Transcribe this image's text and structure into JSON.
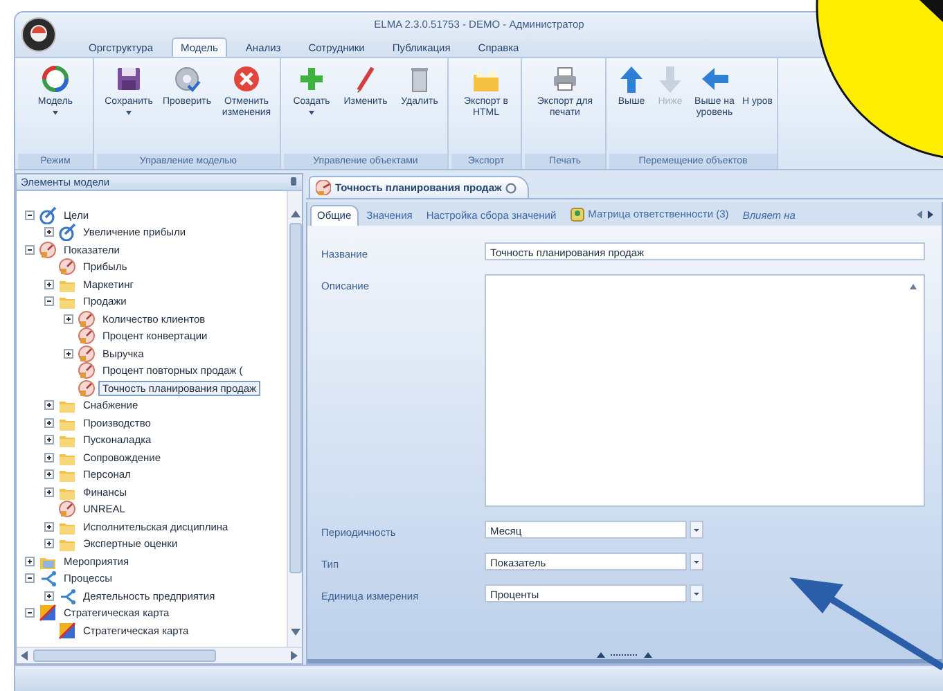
{
  "window": {
    "title": "ELMA 2.3.0.51753 - DEMO - Администратор"
  },
  "menu_tabs": [
    {
      "label": "Оргструктура",
      "selected": false
    },
    {
      "label": "Модель",
      "selected": true
    },
    {
      "label": "Анализ",
      "selected": false
    },
    {
      "label": "Сотрудники",
      "selected": false
    },
    {
      "label": "Публикация",
      "selected": false
    },
    {
      "label": "Справка",
      "selected": false
    }
  ],
  "ribbon": {
    "groups": [
      {
        "label": "Режим",
        "buttons": [
          {
            "label": "Модель",
            "has_menu": true,
            "disabled": false
          }
        ]
      },
      {
        "label": "Управление моделью",
        "buttons": [
          {
            "label": "Сохранить",
            "has_menu": true,
            "disabled": false
          },
          {
            "label": "Проверить",
            "has_menu": false,
            "disabled": false
          },
          {
            "label": "Отменить изменения",
            "has_menu": false,
            "disabled": false
          }
        ]
      },
      {
        "label": "Управление объектами",
        "buttons": [
          {
            "label": "Создать",
            "has_menu": true,
            "disabled": false
          },
          {
            "label": "Изменить",
            "has_menu": false,
            "disabled": false
          },
          {
            "label": "Удалить",
            "has_menu": false,
            "disabled": false
          }
        ]
      },
      {
        "label": "Экспорт",
        "buttons": [
          {
            "label": "Экспорт в HTML",
            "has_menu": false,
            "disabled": false
          }
        ]
      },
      {
        "label": "Печать",
        "buttons": [
          {
            "label": "Экспорт для печати",
            "has_menu": false,
            "disabled": false
          }
        ]
      },
      {
        "label": "Перемещение объектов",
        "buttons": [
          {
            "label": "Выше",
            "has_menu": false,
            "disabled": false
          },
          {
            "label": "Ниже",
            "has_menu": false,
            "disabled": true
          },
          {
            "label": "Выше на уровень",
            "has_menu": false,
            "disabled": false
          },
          {
            "label": "Н уров",
            "has_menu": false,
            "disabled": false
          }
        ]
      }
    ]
  },
  "model_panel": {
    "title": "Элементы модели",
    "tree": [
      {
        "label": "Цели",
        "kind": "goal",
        "expanded": true,
        "selected": false,
        "children": [
          {
            "label": "Увеличение прибыли",
            "kind": "goal",
            "expanded": false,
            "selected": false
          }
        ]
      },
      {
        "label": "Показатели",
        "kind": "indicator",
        "expanded": true,
        "selected": false,
        "children": [
          {
            "label": "Прибыль",
            "kind": "indicator",
            "selected": false
          },
          {
            "label": "Маркетинг",
            "kind": "folder",
            "expanded": false,
            "selected": false
          },
          {
            "label": "Продажи",
            "kind": "folder",
            "expanded": true,
            "selected": false,
            "children": [
              {
                "label": "Количество клиентов",
                "kind": "indicator",
                "expanded": false,
                "selected": false
              },
              {
                "label": "Процент конвертации",
                "kind": "indicator",
                "selected": false
              },
              {
                "label": "Выручка",
                "kind": "indicator",
                "expanded": false,
                "selected": false
              },
              {
                "label": "Процент повторных продаж (",
                "kind": "indicator",
                "selected": false
              },
              {
                "label": "Точность планирования продаж",
                "kind": "indicator",
                "selected": true
              }
            ]
          },
          {
            "label": "Снабжение",
            "kind": "folder",
            "expanded": false,
            "selected": false
          },
          {
            "label": "Производство",
            "kind": "folder",
            "expanded": false,
            "selected": false
          },
          {
            "label": "Пусконаладка",
            "kind": "folder",
            "expanded": false,
            "selected": false
          },
          {
            "label": "Сопровождение",
            "kind": "folder",
            "expanded": false,
            "selected": false
          },
          {
            "label": "Персонал",
            "kind": "folder",
            "expanded": false,
            "selected": false
          },
          {
            "label": "Финансы",
            "kind": "folder",
            "expanded": false,
            "selected": false
          },
          {
            "label": "UNREAL",
            "kind": "indicator",
            "selected": false
          },
          {
            "label": "Исполнительская дисциплина",
            "kind": "folder",
            "expanded": false,
            "selected": false
          },
          {
            "label": "Экспертные оценки",
            "kind": "folder",
            "expanded": false,
            "selected": false
          }
        ]
      },
      {
        "label": "Мероприятия",
        "kind": "events",
        "expanded": false,
        "selected": false
      },
      {
        "label": "Процессы",
        "kind": "process",
        "expanded": true,
        "selected": false,
        "children": [
          {
            "label": "Деятельность предприятия",
            "kind": "process",
            "expanded": false,
            "selected": false
          }
        ]
      },
      {
        "label": "Стратегическая карта",
        "kind": "map",
        "expanded": true,
        "selected": false,
        "children": [
          {
            "label": "Стратегическая карта",
            "kind": "map",
            "selected": false
          }
        ]
      }
    ]
  },
  "document": {
    "tab": {
      "label": "Точность планирования продаж"
    },
    "subtabs": [
      {
        "label": "Общие",
        "kind": "text",
        "selected": true
      },
      {
        "label": "Значения",
        "kind": "text",
        "selected": false
      },
      {
        "label": "Настройка сбора значений",
        "kind": "text",
        "selected": false
      },
      {
        "label": "Матрица ответственности (3)",
        "kind": "icon",
        "selected": false
      },
      {
        "label": "Влияет на",
        "kind": "text",
        "selected": false
      }
    ],
    "fields": [
      {
        "label": "Название",
        "kind": "text",
        "value": "Точность планирования продаж"
      },
      {
        "label": "Описание",
        "kind": "memo"
      },
      {
        "label": "Периодичность",
        "kind": "select",
        "value": "Месяц"
      },
      {
        "label": "Тип",
        "kind": "select",
        "value": "Показатель"
      },
      {
        "label": "Единица измерения",
        "kind": "select",
        "value": "Проценты"
      }
    ]
  }
}
